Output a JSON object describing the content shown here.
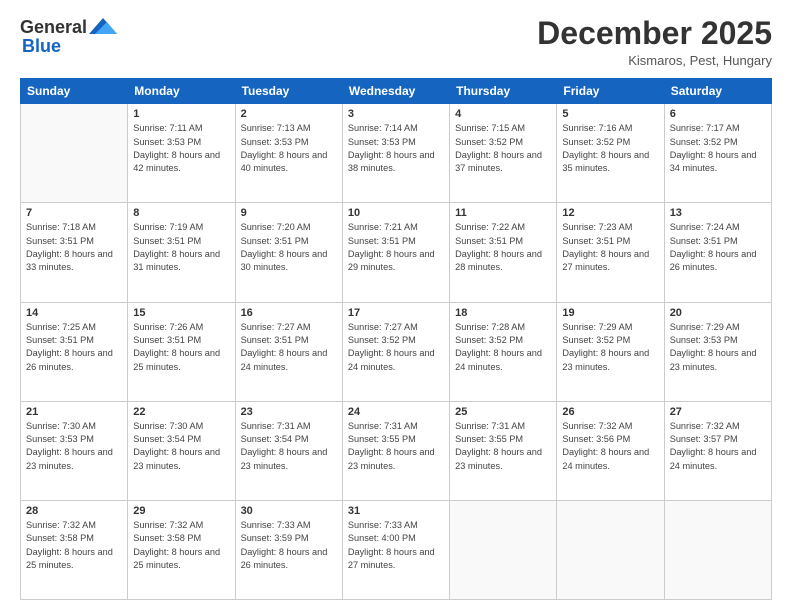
{
  "header": {
    "logo_general": "General",
    "logo_blue": "Blue",
    "month": "December 2025",
    "location": "Kismaros, Pest, Hungary"
  },
  "weekdays": [
    "Sunday",
    "Monday",
    "Tuesday",
    "Wednesday",
    "Thursday",
    "Friday",
    "Saturday"
  ],
  "weeks": [
    [
      {
        "day": "",
        "sunrise": "",
        "sunset": "",
        "daylight": ""
      },
      {
        "day": "1",
        "sunrise": "Sunrise: 7:11 AM",
        "sunset": "Sunset: 3:53 PM",
        "daylight": "Daylight: 8 hours and 42 minutes."
      },
      {
        "day": "2",
        "sunrise": "Sunrise: 7:13 AM",
        "sunset": "Sunset: 3:53 PM",
        "daylight": "Daylight: 8 hours and 40 minutes."
      },
      {
        "day": "3",
        "sunrise": "Sunrise: 7:14 AM",
        "sunset": "Sunset: 3:53 PM",
        "daylight": "Daylight: 8 hours and 38 minutes."
      },
      {
        "day": "4",
        "sunrise": "Sunrise: 7:15 AM",
        "sunset": "Sunset: 3:52 PM",
        "daylight": "Daylight: 8 hours and 37 minutes."
      },
      {
        "day": "5",
        "sunrise": "Sunrise: 7:16 AM",
        "sunset": "Sunset: 3:52 PM",
        "daylight": "Daylight: 8 hours and 35 minutes."
      },
      {
        "day": "6",
        "sunrise": "Sunrise: 7:17 AM",
        "sunset": "Sunset: 3:52 PM",
        "daylight": "Daylight: 8 hours and 34 minutes."
      }
    ],
    [
      {
        "day": "7",
        "sunrise": "Sunrise: 7:18 AM",
        "sunset": "Sunset: 3:51 PM",
        "daylight": "Daylight: 8 hours and 33 minutes."
      },
      {
        "day": "8",
        "sunrise": "Sunrise: 7:19 AM",
        "sunset": "Sunset: 3:51 PM",
        "daylight": "Daylight: 8 hours and 31 minutes."
      },
      {
        "day": "9",
        "sunrise": "Sunrise: 7:20 AM",
        "sunset": "Sunset: 3:51 PM",
        "daylight": "Daylight: 8 hours and 30 minutes."
      },
      {
        "day": "10",
        "sunrise": "Sunrise: 7:21 AM",
        "sunset": "Sunset: 3:51 PM",
        "daylight": "Daylight: 8 hours and 29 minutes."
      },
      {
        "day": "11",
        "sunrise": "Sunrise: 7:22 AM",
        "sunset": "Sunset: 3:51 PM",
        "daylight": "Daylight: 8 hours and 28 minutes."
      },
      {
        "day": "12",
        "sunrise": "Sunrise: 7:23 AM",
        "sunset": "Sunset: 3:51 PM",
        "daylight": "Daylight: 8 hours and 27 minutes."
      },
      {
        "day": "13",
        "sunrise": "Sunrise: 7:24 AM",
        "sunset": "Sunset: 3:51 PM",
        "daylight": "Daylight: 8 hours and 26 minutes."
      }
    ],
    [
      {
        "day": "14",
        "sunrise": "Sunrise: 7:25 AM",
        "sunset": "Sunset: 3:51 PM",
        "daylight": "Daylight: 8 hours and 26 minutes."
      },
      {
        "day": "15",
        "sunrise": "Sunrise: 7:26 AM",
        "sunset": "Sunset: 3:51 PM",
        "daylight": "Daylight: 8 hours and 25 minutes."
      },
      {
        "day": "16",
        "sunrise": "Sunrise: 7:27 AM",
        "sunset": "Sunset: 3:51 PM",
        "daylight": "Daylight: 8 hours and 24 minutes."
      },
      {
        "day": "17",
        "sunrise": "Sunrise: 7:27 AM",
        "sunset": "Sunset: 3:52 PM",
        "daylight": "Daylight: 8 hours and 24 minutes."
      },
      {
        "day": "18",
        "sunrise": "Sunrise: 7:28 AM",
        "sunset": "Sunset: 3:52 PM",
        "daylight": "Daylight: 8 hours and 24 minutes."
      },
      {
        "day": "19",
        "sunrise": "Sunrise: 7:29 AM",
        "sunset": "Sunset: 3:52 PM",
        "daylight": "Daylight: 8 hours and 23 minutes."
      },
      {
        "day": "20",
        "sunrise": "Sunrise: 7:29 AM",
        "sunset": "Sunset: 3:53 PM",
        "daylight": "Daylight: 8 hours and 23 minutes."
      }
    ],
    [
      {
        "day": "21",
        "sunrise": "Sunrise: 7:30 AM",
        "sunset": "Sunset: 3:53 PM",
        "daylight": "Daylight: 8 hours and 23 minutes."
      },
      {
        "day": "22",
        "sunrise": "Sunrise: 7:30 AM",
        "sunset": "Sunset: 3:54 PM",
        "daylight": "Daylight: 8 hours and 23 minutes."
      },
      {
        "day": "23",
        "sunrise": "Sunrise: 7:31 AM",
        "sunset": "Sunset: 3:54 PM",
        "daylight": "Daylight: 8 hours and 23 minutes."
      },
      {
        "day": "24",
        "sunrise": "Sunrise: 7:31 AM",
        "sunset": "Sunset: 3:55 PM",
        "daylight": "Daylight: 8 hours and 23 minutes."
      },
      {
        "day": "25",
        "sunrise": "Sunrise: 7:31 AM",
        "sunset": "Sunset: 3:55 PM",
        "daylight": "Daylight: 8 hours and 23 minutes."
      },
      {
        "day": "26",
        "sunrise": "Sunrise: 7:32 AM",
        "sunset": "Sunset: 3:56 PM",
        "daylight": "Daylight: 8 hours and 24 minutes."
      },
      {
        "day": "27",
        "sunrise": "Sunrise: 7:32 AM",
        "sunset": "Sunset: 3:57 PM",
        "daylight": "Daylight: 8 hours and 24 minutes."
      }
    ],
    [
      {
        "day": "28",
        "sunrise": "Sunrise: 7:32 AM",
        "sunset": "Sunset: 3:58 PM",
        "daylight": "Daylight: 8 hours and 25 minutes."
      },
      {
        "day": "29",
        "sunrise": "Sunrise: 7:32 AM",
        "sunset": "Sunset: 3:58 PM",
        "daylight": "Daylight: 8 hours and 25 minutes."
      },
      {
        "day": "30",
        "sunrise": "Sunrise: 7:33 AM",
        "sunset": "Sunset: 3:59 PM",
        "daylight": "Daylight: 8 hours and 26 minutes."
      },
      {
        "day": "31",
        "sunrise": "Sunrise: 7:33 AM",
        "sunset": "Sunset: 4:00 PM",
        "daylight": "Daylight: 8 hours and 27 minutes."
      },
      {
        "day": "",
        "sunrise": "",
        "sunset": "",
        "daylight": ""
      },
      {
        "day": "",
        "sunrise": "",
        "sunset": "",
        "daylight": ""
      },
      {
        "day": "",
        "sunrise": "",
        "sunset": "",
        "daylight": ""
      }
    ]
  ]
}
